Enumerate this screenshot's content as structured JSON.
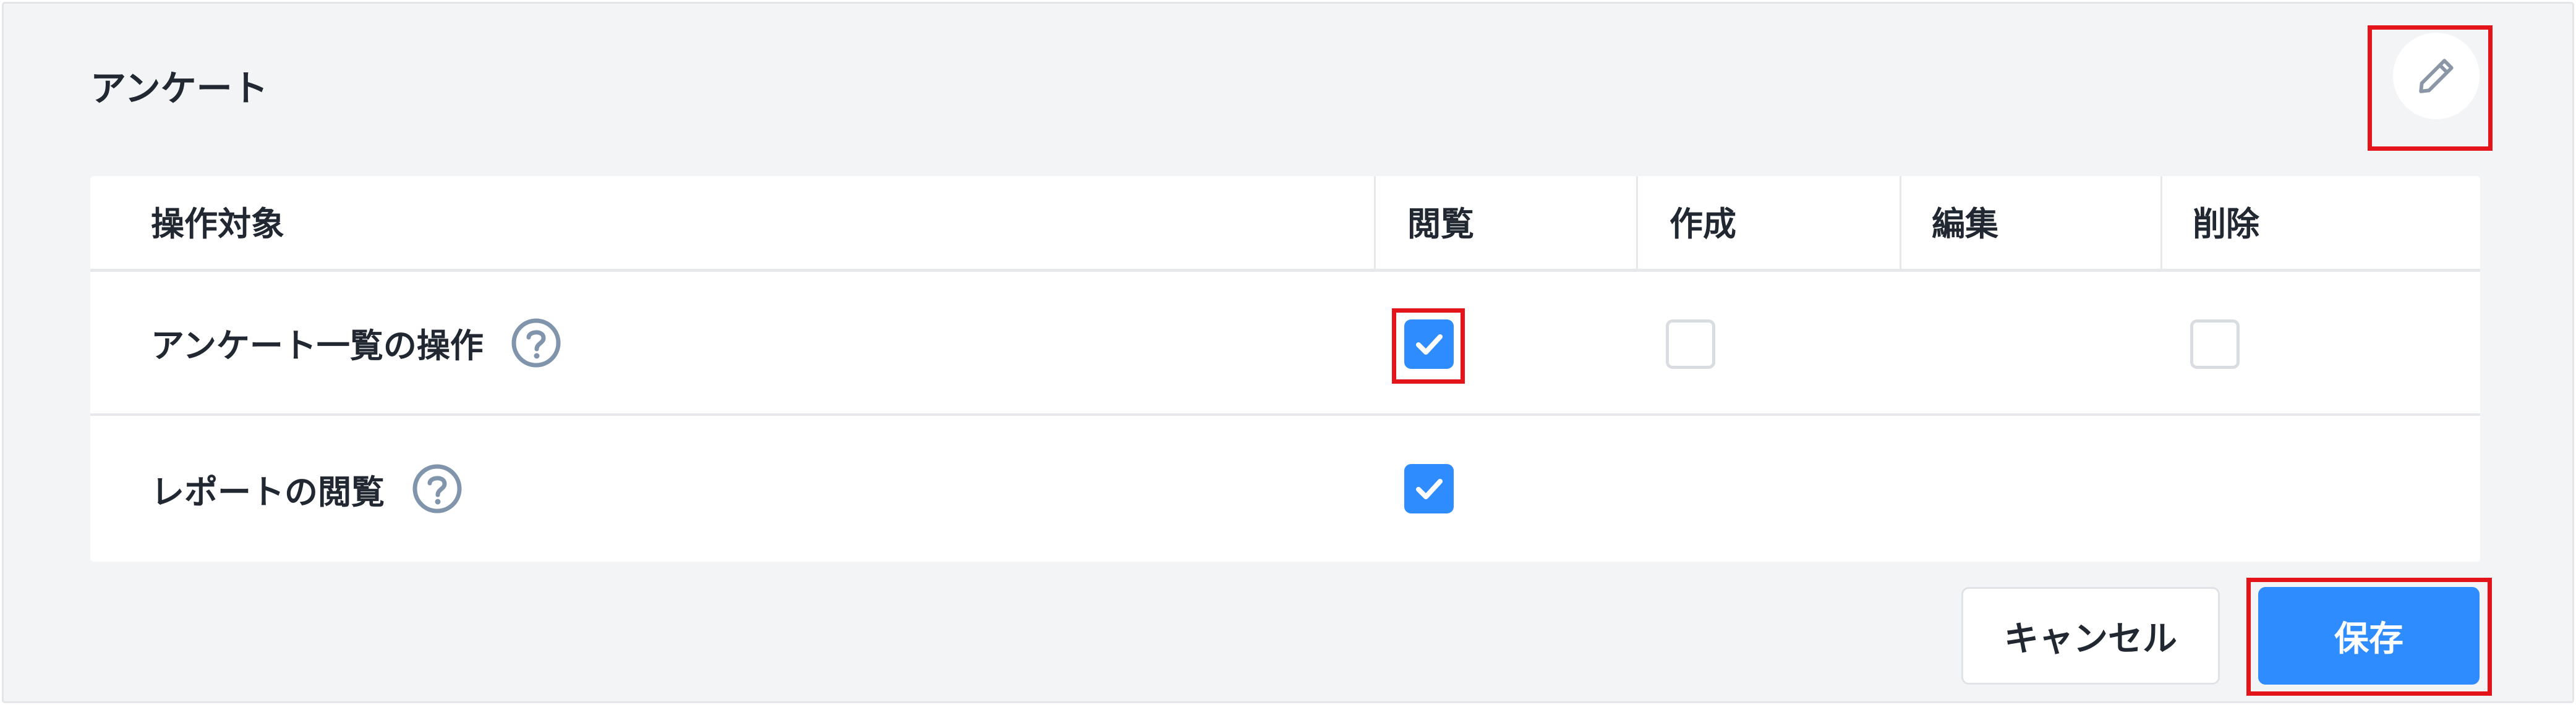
{
  "panel": {
    "title": "アンケート"
  },
  "table": {
    "headers": {
      "target": "操作対象",
      "view": "閲覧",
      "create": "作成",
      "edit": "編集",
      "delete": "削除"
    },
    "rows": [
      {
        "label": "アンケート一覧の操作",
        "view": true,
        "create": false,
        "delete": false
      },
      {
        "label": "レポートの閲覧",
        "view": true
      }
    ]
  },
  "buttons": {
    "cancel": "キャンセル",
    "save": "保存"
  },
  "colors": {
    "accent": "#2f8cff",
    "highlight": "#e3141a",
    "help_icon": "#8095ab",
    "edit_icon": "#8b97a6"
  }
}
